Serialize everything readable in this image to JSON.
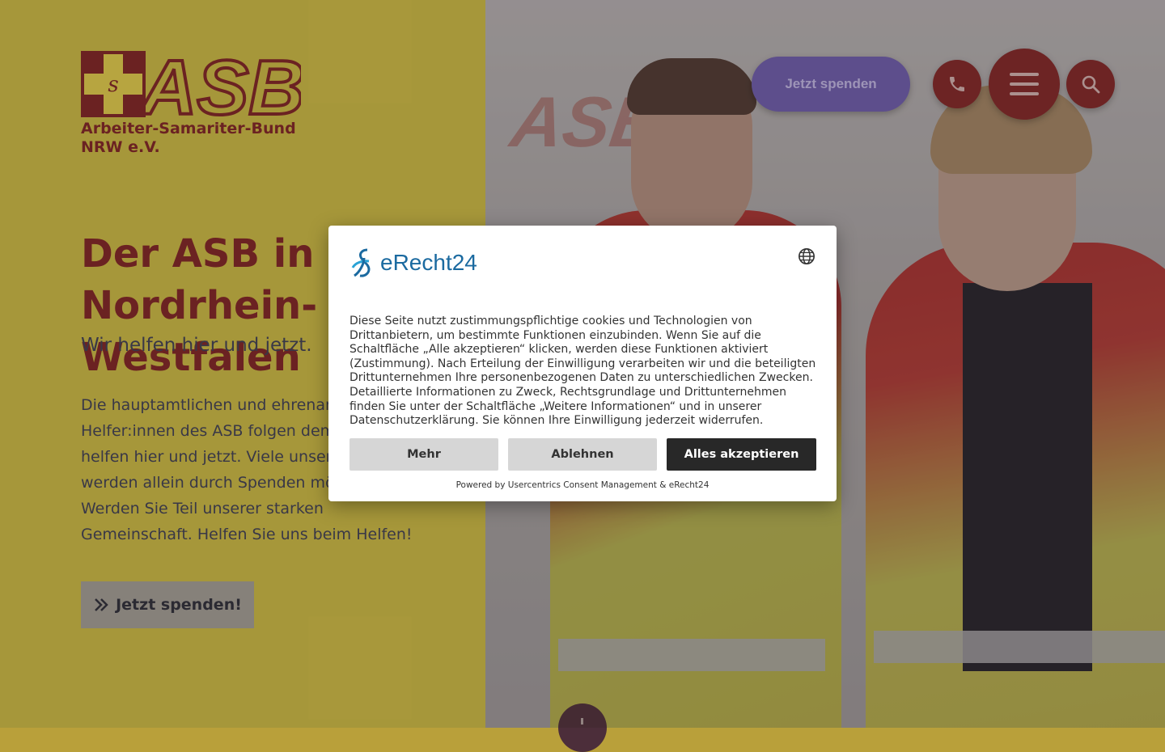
{
  "logo": {
    "wordmark": "ASB",
    "name_line1": "Arbeiter-Samariter-Bund",
    "name_line2": "NRW e.V."
  },
  "header": {
    "donate_label": "Jetzt spenden",
    "phone_icon": "phone-icon",
    "menu_icon": "hamburger-icon",
    "search_icon": "search-icon"
  },
  "hero": {
    "title": "Der ASB in Nordrhein-Westfalen",
    "subtitle": "Wir helfen hier und jetzt.",
    "body": "Die hauptamtlichen und ehrenamtlichen Helfer:innen des ASB folgen dem Motto: Wir helfen hier und jetzt. Viele unserer Projekte werden allein durch Spenden möglich. Werden Sie Teil unserer starken Gemeinschaft. Helfen Sie uns beim Helfen!",
    "cta_label": "Jetzt spenden!",
    "cta_icon": "double-chevron-right-icon",
    "photo_sign_text": "ASB"
  },
  "consent": {
    "brand": "eRecht24",
    "language_icon": "globe-icon",
    "text": "Diese Seite nutzt zustimmungspflichtige cookies und Technologien von Drittanbietern, um bestimmte Funktionen einzubinden. Wenn Sie auf die Schaltfläche „Alle akzeptieren“ klicken, werden diese Funktionen aktiviert (Zustimmung). Nach Erteilung der Einwilligung verarbeiten wir und die beteiligten Drittunternehmen Ihre personenbezogenen Daten zu unterschiedlichen Zwecken. Detaillierte Informationen zu Zweck, Rechtsgrundlage und Drittunternehmen finden Sie unter der Schaltfläche „Weitere Informationen“ und in unserer Datenschutzerklärung. Sie können Ihre Einwilligung jederzeit widerrufen.",
    "more_label": "Mehr",
    "deny_label": "Ablehnen",
    "accept_label": "Alles akzeptieren",
    "powered_by": "Powered by Usercentrics Consent Management & eRecht24"
  },
  "colors": {
    "brand_red": "#7b2325",
    "panel_yellow": "#d7c34a",
    "donate_purple": "#6a58a6",
    "accept_dark": "#282828"
  }
}
